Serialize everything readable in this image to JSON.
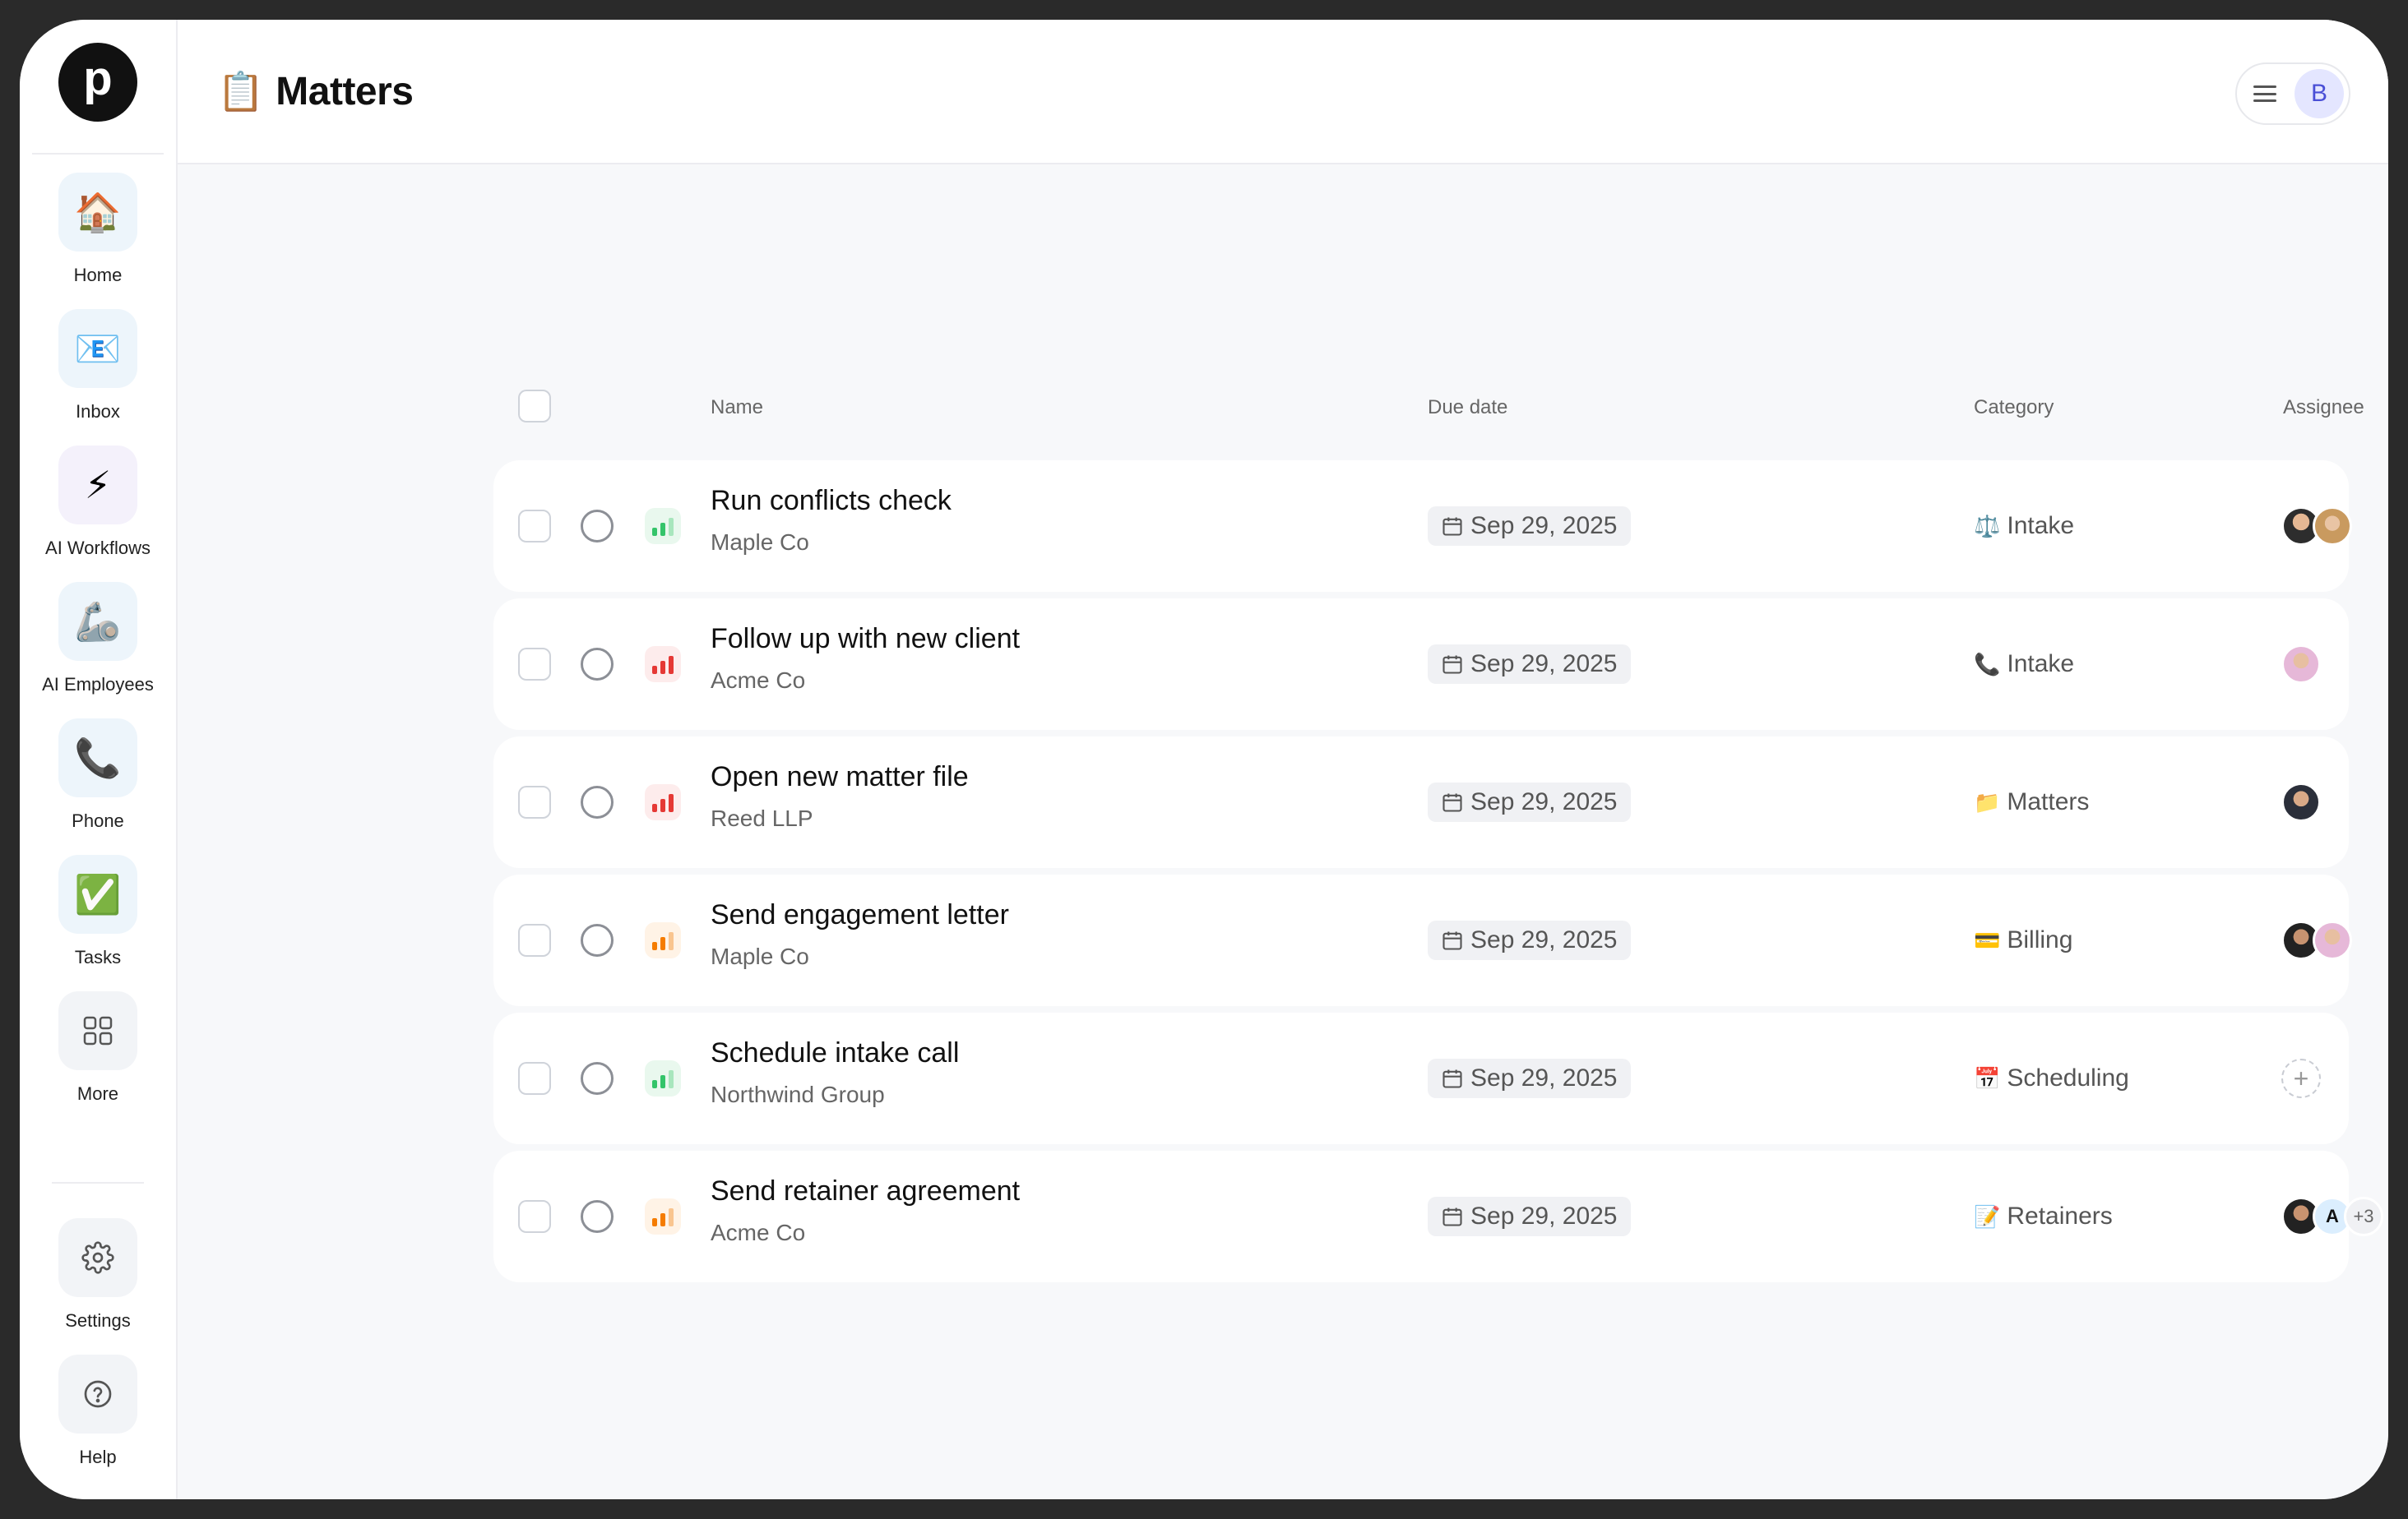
{
  "app": {
    "logo_letter": "p"
  },
  "sidebar": {
    "items": [
      {
        "label": "Home",
        "icon": "🏠"
      },
      {
        "label": "Inbox",
        "icon": "📧"
      },
      {
        "label": "AI Workflows",
        "icon": "⚡"
      },
      {
        "label": "AI Employees",
        "icon": "🦾"
      },
      {
        "label": "Phone",
        "icon": "📞"
      },
      {
        "label": "Tasks",
        "icon": "✅"
      },
      {
        "label": "More",
        "icon": "grid-icon"
      }
    ],
    "bottom": [
      {
        "label": "Settings",
        "icon": "gear-icon"
      },
      {
        "label": "Help",
        "icon": "help-icon"
      }
    ]
  },
  "header": {
    "title_emoji": "📋",
    "title": "Matters",
    "user_initial": "B"
  },
  "table": {
    "columns": {
      "name": "Name",
      "due": "Due date",
      "category": "Category",
      "assignee": "Assignee"
    },
    "rows": [
      {
        "name": "Run conflicts check",
        "client": "Maple Co",
        "priority": "low",
        "due": "Sep 29, 2025",
        "category_icon": "⚖️",
        "category": "Intake"
      },
      {
        "name": "Follow up with new client",
        "client": "Acme Co",
        "priority": "high",
        "due": "Sep 29, 2025",
        "category_icon": "📞",
        "category": "Intake"
      },
      {
        "name": "Open new matter file",
        "client": "Reed LLP",
        "priority": "high",
        "due": "Sep 29, 2025",
        "category_icon": "📁",
        "category": "Matters"
      },
      {
        "name": "Send engagement letter",
        "client": "Maple Co",
        "priority": "medium",
        "due": "Sep 29, 2025",
        "category_icon": "💳",
        "category": "Billing"
      },
      {
        "name": "Schedule intake call",
        "client": "Northwind Group",
        "priority": "low",
        "due": "Sep 29, 2025",
        "category_icon": "📅",
        "category": "Scheduling"
      },
      {
        "name": "Send retainer agreement",
        "client": "Acme Co",
        "priority": "medium",
        "due": "Sep 29, 2025",
        "category_icon": "📝",
        "category": "Retainers",
        "assignee_letter": "A",
        "assignee_more": "+3"
      }
    ]
  },
  "colors": {
    "priority_low": "#34c46a",
    "priority_high": "#e53935",
    "priority_medium": "#f57c00"
  }
}
